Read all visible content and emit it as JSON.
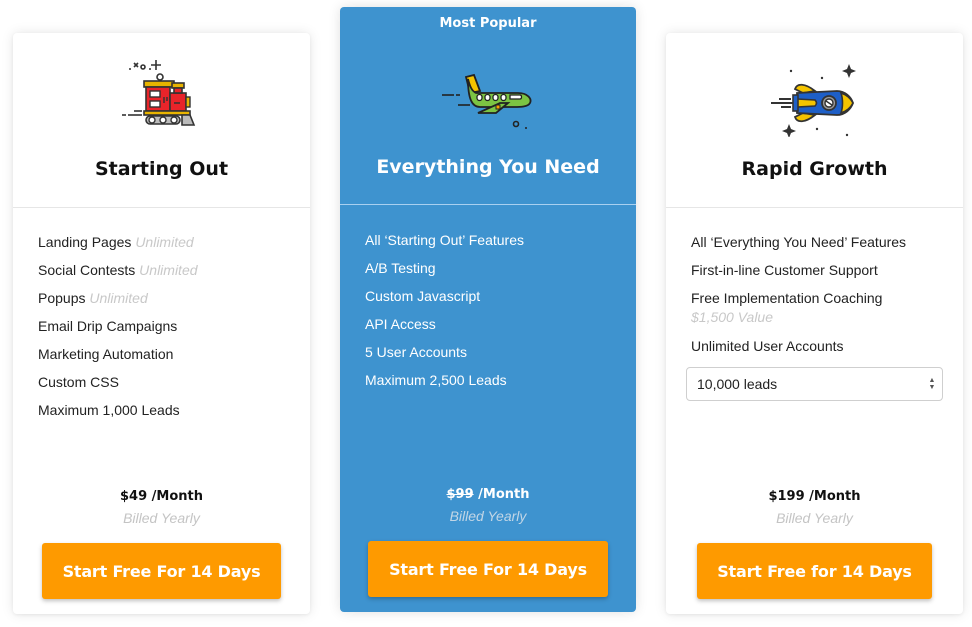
{
  "plans": [
    {
      "id": "starting-out",
      "badge": null,
      "icon": "train-icon",
      "title": "Starting Out",
      "features": [
        {
          "label": "Landing Pages",
          "note": "Unlimited"
        },
        {
          "label": "Social Contests",
          "note": "Unlimited"
        },
        {
          "label": "Popups",
          "note": "Unlimited"
        },
        {
          "label": "Email Drip Campaigns"
        },
        {
          "label": "Marketing Automation"
        },
        {
          "label": "Custom CSS"
        },
        {
          "label": "Maximum 1,000 Leads"
        }
      ],
      "price_amount": "$49",
      "price_period": " /Month",
      "billing": "Billed Yearly",
      "cta_label": "Start Free For 14 Days"
    },
    {
      "id": "everything-you-need",
      "badge": "Most Popular",
      "icon": "airplane-icon",
      "title": "Everything You Need",
      "features": [
        {
          "label": "All ‘Starting Out’ Features"
        },
        {
          "label": "A/B Testing"
        },
        {
          "label": "Custom Javascript"
        },
        {
          "label": "API Access"
        },
        {
          "label": "5 User Accounts"
        },
        {
          "label": "Maximum 2,500 Leads"
        }
      ],
      "price_amount": "$99",
      "price_amount_struck": true,
      "price_period": " /Month",
      "billing": "Billed Yearly",
      "cta_label": "Start Free For 14 Days"
    },
    {
      "id": "rapid-growth",
      "badge": null,
      "icon": "rocket-icon",
      "title": "Rapid Growth",
      "features": [
        {
          "label": "All ‘Everything You Need’ Features"
        },
        {
          "label": "First-in-line Customer Support"
        },
        {
          "label": "Free Implementation Coaching",
          "sub": "$1,500 Value"
        },
        {
          "label": "Unlimited User Accounts"
        }
      ],
      "leads_select": {
        "selected": "10,000 leads"
      },
      "price_amount": "$199",
      "price_period": " /Month",
      "billing": "Billed Yearly",
      "cta_label": "Start Free for 14 Days"
    }
  ],
  "colors": {
    "featured_bg": "#3e93cf",
    "cta_bg": "#fe9a00",
    "note_text": "#c8c8c8"
  }
}
